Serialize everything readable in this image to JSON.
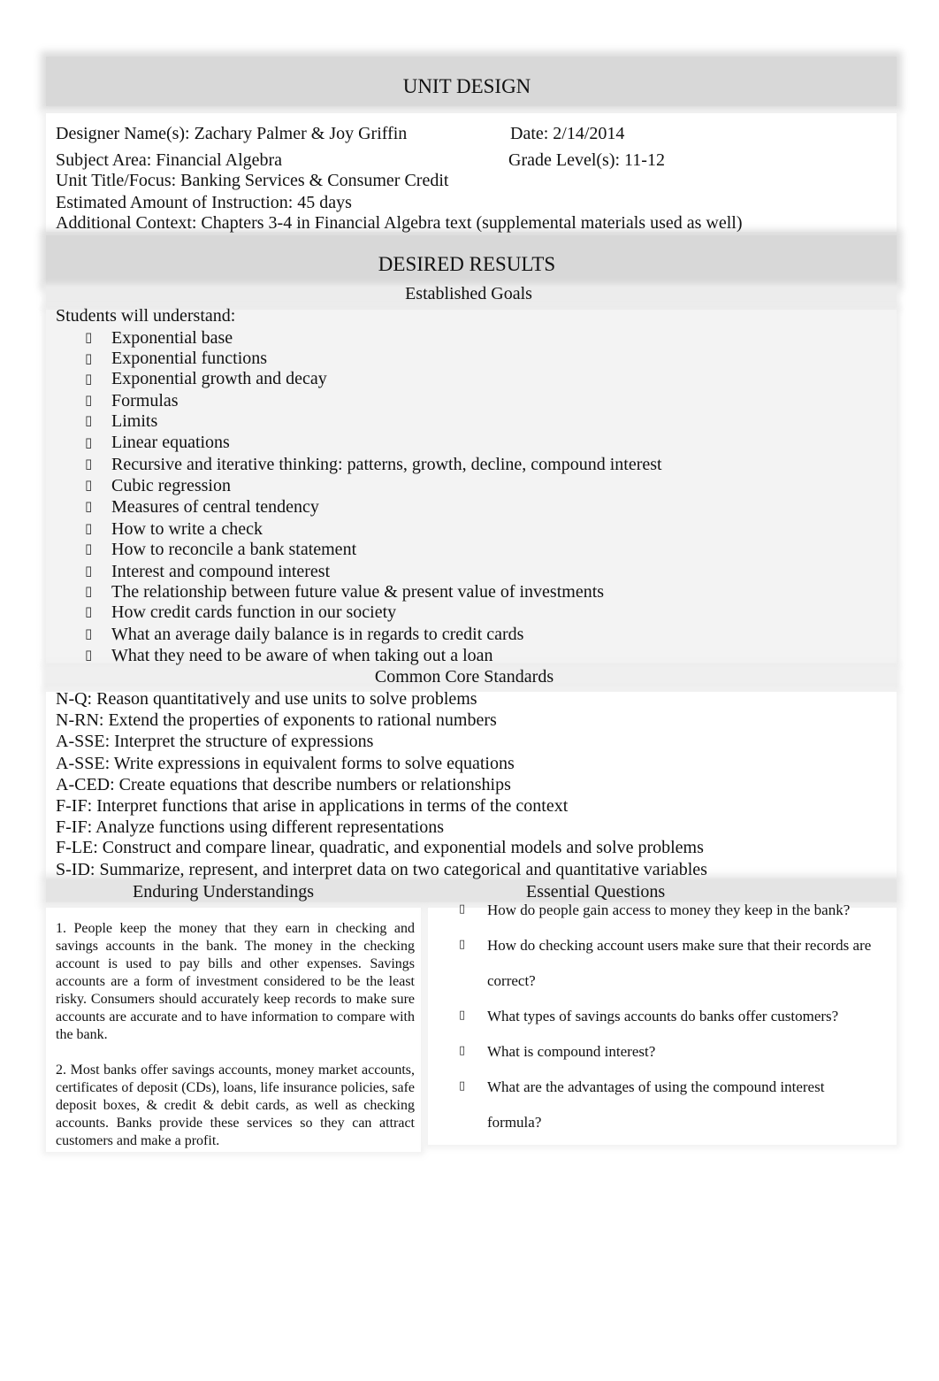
{
  "header": {
    "title": "UNIT DESIGN",
    "designer_label": "Designer Name(s):  Zachary Palmer & Joy Griffin",
    "date_label": "Date: 2/14/2014",
    "subject_label": "Subject Area: Financial Algebra",
    "grade_label": "Grade Level(s): 11-12",
    "unit_title_label": "Unit Title/Focus: Banking Services & Consumer Credit",
    "instruction_label": "Estimated Amount of Instruction:  45 days",
    "context_label": "Additional Context:  Chapters 3-4 in Financial Algebra text (supplemental materials used as well)"
  },
  "desired_results": {
    "title": "DESIRED RESULTS",
    "established_goals": {
      "heading": "Established Goals",
      "intro": "Students will understand:",
      "bullet_icon": "square-bullet-icon",
      "items": [
        "Exponential base",
        "Exponential functions",
        "Exponential growth and decay",
        "Formulas",
        "Limits",
        "Linear equations",
        "Recursive and iterative thinking: patterns, growth, decline, compound interest",
        "Cubic regression",
        "Measures of central tendency",
        "How to write a check",
        "How to reconcile a bank statement",
        "Interest and compound interest",
        "The relationship between future value & present value of investments",
        "How credit cards function in our society",
        "What an average daily balance is in regards to credit cards",
        "What they need to be aware of when taking out a loan"
      ]
    },
    "common_core": {
      "heading": "Common Core Standards",
      "items": [
        "N-Q: Reason quantitatively and use units to solve problems",
        "N-RN: Extend the properties of exponents to rational numbers",
        "A-SSE: Interpret the structure of expressions",
        "A-SSE: Write expressions in equivalent forms to solve equations",
        "A-CED: Create equations that describe numbers or relationships",
        "F-IF: Interpret functions that arise in applications in terms of the context",
        "F-IF: Analyze functions using different representations",
        "F-LE: Construct and compare linear, quadratic, and exponential models and solve problems",
        "S-ID: Summarize, represent, and interpret data on two categorical and quantitative variables"
      ]
    },
    "enduring_understandings": {
      "heading": "Enduring Understandings",
      "paragraphs": [
        "1. People keep the money that they earn in checking and savings accounts in the bank. The money in the checking account is used to pay bills and other expenses. Savings accounts are a form of investment considered to be the least risky. Consumers should accurately keep records to make sure accounts are accurate and to have information to compare with the bank.",
        "2. Most banks offer savings accounts, money market accounts, certificates of deposit (CDs), loans, life insurance policies, safe deposit boxes, & credit & debit cards, as well as checking accounts. Banks provide these services so they can attract customers and make a profit."
      ]
    },
    "essential_questions": {
      "heading": "Essential Questions",
      "bullet_icon": "square-bullet-icon",
      "items": [
        {
          "line1": "How do people gain access to money they keep in the bank?",
          "line2": ""
        },
        {
          "line1": "How do checking account users make sure that their records are",
          "line2": "correct?"
        },
        {
          "line1": "What types of savings accounts do banks offer customers?",
          "line2": ""
        },
        {
          "line1": "What is compound interest?",
          "line2": ""
        },
        {
          "line1": "What are the advantages of using the compound interest",
          "line2": "formula?"
        }
      ]
    }
  }
}
